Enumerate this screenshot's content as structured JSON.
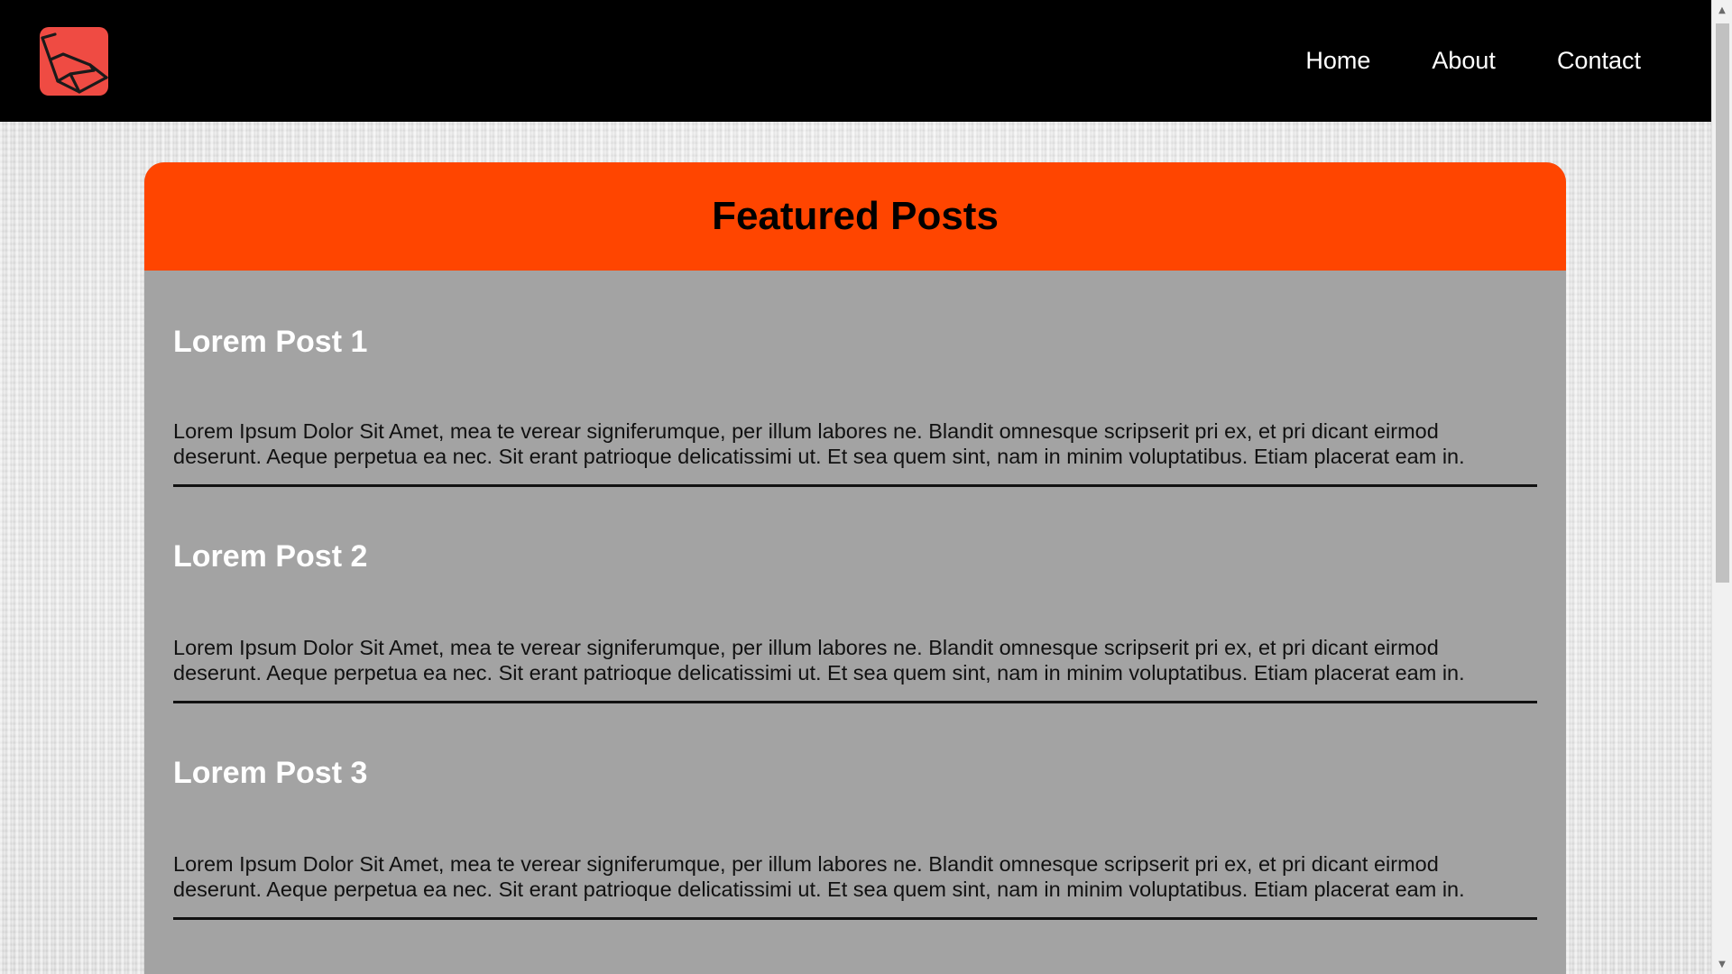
{
  "header": {
    "logo_icon": "laravel-logo-icon",
    "nav": [
      {
        "label": "Home"
      },
      {
        "label": "About"
      },
      {
        "label": "Contact"
      }
    ]
  },
  "featured": {
    "title": "Featured Posts",
    "posts": [
      {
        "title": "Lorem Post 1",
        "body": "Lorem Ipsum Dolor Sit Amet, mea te verear signiferumque, per illum labores ne. Blandit omnesque scripserit pri ex, et pri dicant eirmod\ndeserunt. Aeque perpetua ea nec. Sit erant patrioque delicatissimi ut. Et sea quem sint, nam in minim voluptatibus. Etiam placerat eam in."
      },
      {
        "title": "Lorem Post 2",
        "body": "Lorem Ipsum Dolor Sit Amet, mea te verear signiferumque, per illum labores ne. Blandit omnesque scripserit pri ex, et pri dicant eirmod\ndeserunt. Aeque perpetua ea nec. Sit erant patrioque delicatissimi ut. Et sea quem sint, nam in minim voluptatibus. Etiam placerat eam in."
      },
      {
        "title": "Lorem Post 3",
        "body": "Lorem Ipsum Dolor Sit Amet, mea te verear signiferumque, per illum labores ne. Blandit omnesque scripserit pri ex, et pri dicant eirmod\ndeserunt. Aeque perpetua ea nec. Sit erant patrioque delicatissimi ut. Et sea quem sint, nam in minim voluptatibus. Etiam placerat eam in."
      }
    ]
  },
  "colors": {
    "header_bg": "#000000",
    "logo_bg": "#ef4b43",
    "card_header_bg": "#ff4500",
    "card_body_bg": "#a3a3a3",
    "post_title_color": "#ffffff",
    "post_body_color": "#111111"
  },
  "scrollbar": {
    "up_icon": "scroll-up-arrow-icon",
    "down_icon": "scroll-down-arrow-icon"
  }
}
